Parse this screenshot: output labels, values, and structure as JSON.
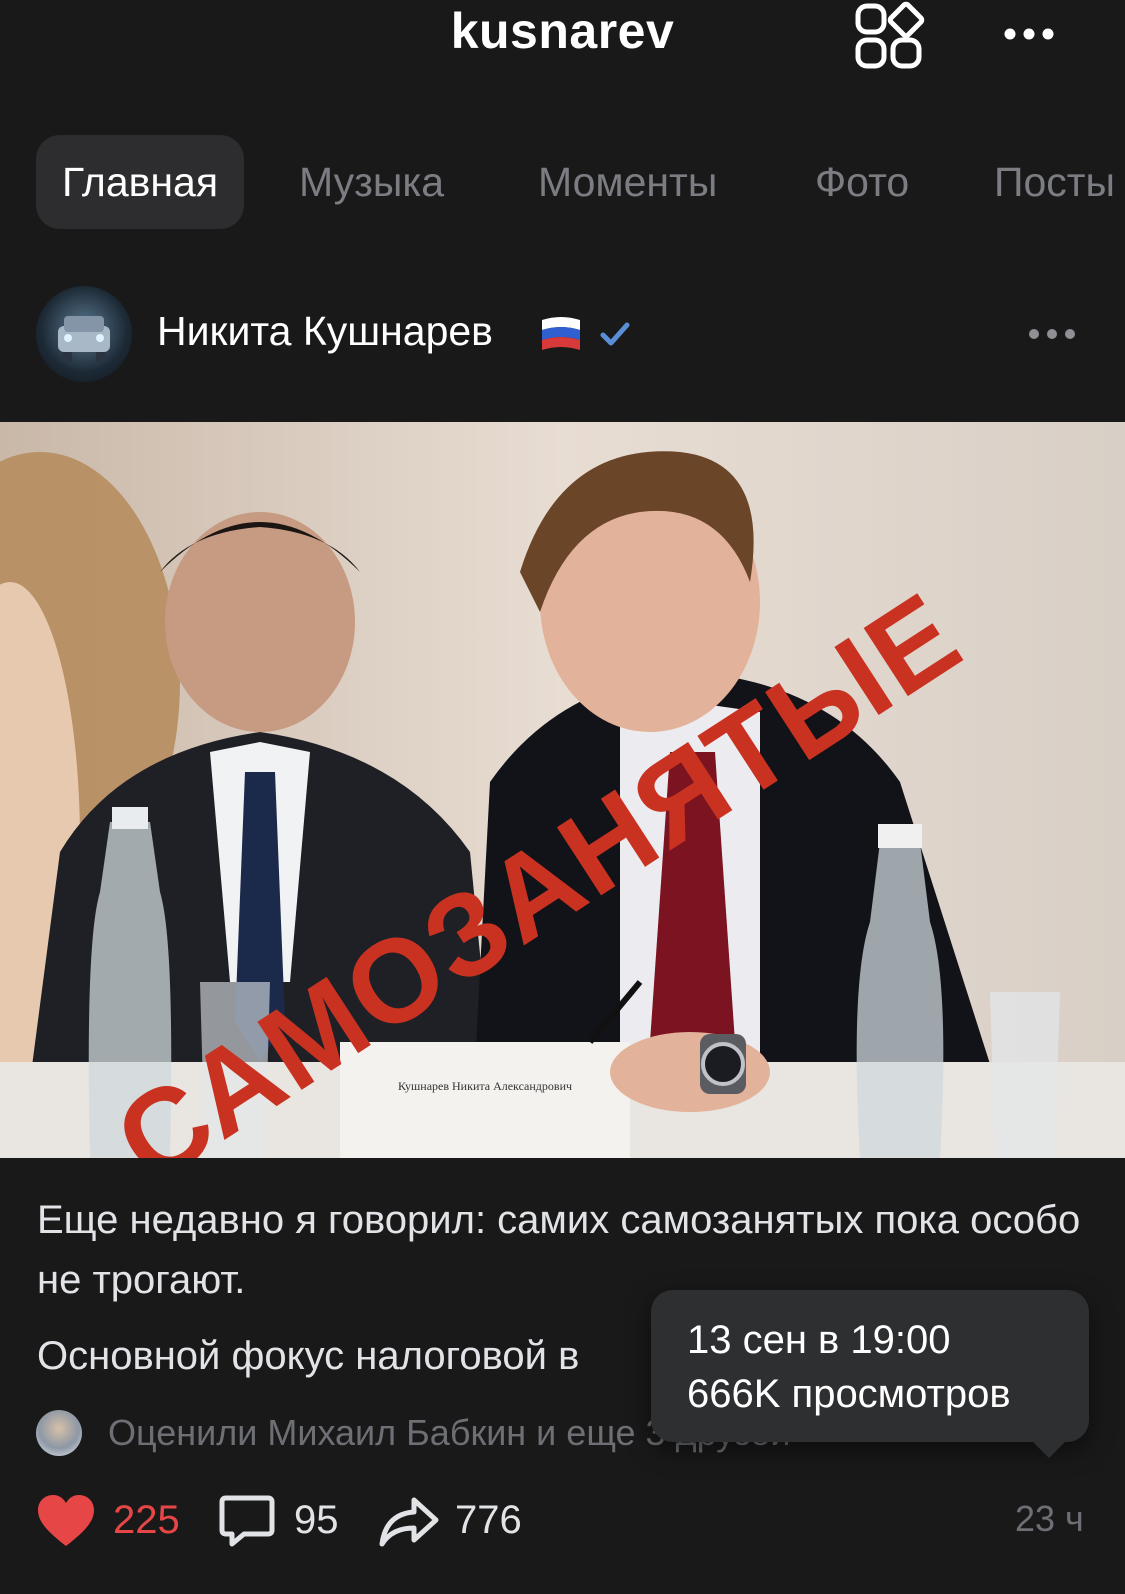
{
  "header": {
    "title": "kusnarev",
    "apps_icon": "apps-grid-icon",
    "more_icon": "more-horizontal-icon"
  },
  "tabs": [
    {
      "label": "Главная",
      "active": true
    },
    {
      "label": "Музыка",
      "active": false
    },
    {
      "label": "Моменты",
      "active": false
    },
    {
      "label": "Фото",
      "active": false
    },
    {
      "label": "Посты",
      "active": false
    }
  ],
  "post": {
    "author": "Никита Кушнарев",
    "author_flag": "russia-flag-icon",
    "verified_icon": "verified-check-icon",
    "image_overlay_text": "САМОЗАНЯТЫЕ",
    "name_card_text": "Кушнарев Никита Александрович",
    "text_paragraph_1": "Еще недавно я говорил: самих самозанятых пока особо не трогают.",
    "text_paragraph_2": "Основной фокус налоговой в",
    "liked_by": "Оценили Михаил Бабкин и еще 3 друзей",
    "likes": "225",
    "comments": "95",
    "shares": "776",
    "time": "23 ч",
    "accent_like_color": "#e64646"
  },
  "tooltip": {
    "date": "13 сен в 19:00",
    "views": "666K просмотров"
  }
}
